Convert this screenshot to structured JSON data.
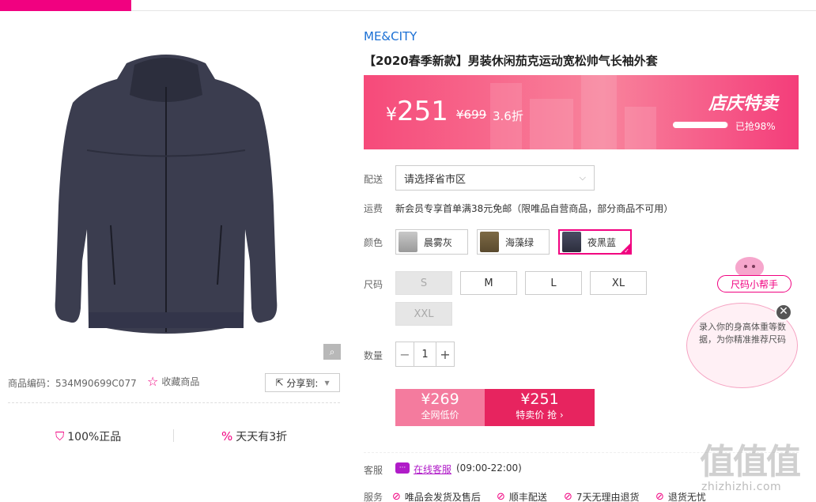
{
  "header": {
    "accent_color": "#f10180"
  },
  "gallery": {
    "zoom_icon": "magnifier-icon",
    "product_code": "商品编码：534M90699C077",
    "favorite_label": "收藏商品",
    "share_label": "分享到:"
  },
  "guarantees": {
    "authentic": "100%正品",
    "daily_discount": "天天有3折"
  },
  "product": {
    "brand": "ME&CITY",
    "title": "【2020春季新款】男装休闲茄克运动宽松帅气长袖外套"
  },
  "promo": {
    "currency": "¥",
    "price": "251",
    "original_price": "¥699",
    "discount": "3.6折",
    "event": "店庆特卖",
    "sold_percent": 0.98,
    "sold_text": "已抢98%"
  },
  "shipping": {
    "label": "配送",
    "placeholder": "请选择省市区"
  },
  "fee": {
    "label": "运费",
    "text": "新会员专享首单满38元免邮（限唯品自营商品，部分商品不可用）"
  },
  "colors": {
    "label": "颜色",
    "options": [
      "晨雾灰",
      "海藻绿",
      "夜黑蓝"
    ],
    "selected": "夜黑蓝"
  },
  "sizes": {
    "label": "尺码",
    "options": [
      "S",
      "M",
      "L",
      "XL",
      "XXL"
    ]
  },
  "quantity": {
    "label": "数量",
    "value": "1",
    "minus": "−",
    "plus": "+"
  },
  "buy": {
    "network_price": "¥269",
    "network_label": "全网低价",
    "sale_price": "¥251",
    "sale_label": "特卖价 抢 ›"
  },
  "service_contact": {
    "label": "客服",
    "link": "在线客服",
    "hours": "(09:00-22:00)"
  },
  "services": {
    "label": "服务",
    "items": [
      "唯品会发货及售后",
      "顺丰配送",
      "7天无理由退货",
      "退货无忧"
    ]
  },
  "size_helper": {
    "tag": "尺码小帮手",
    "text": "录入你的身高体重等数据，为你精准推荐尺码",
    "close": "✕"
  },
  "watermark": {
    "logo": "值值值",
    "url": "zhizhizhi.com"
  }
}
